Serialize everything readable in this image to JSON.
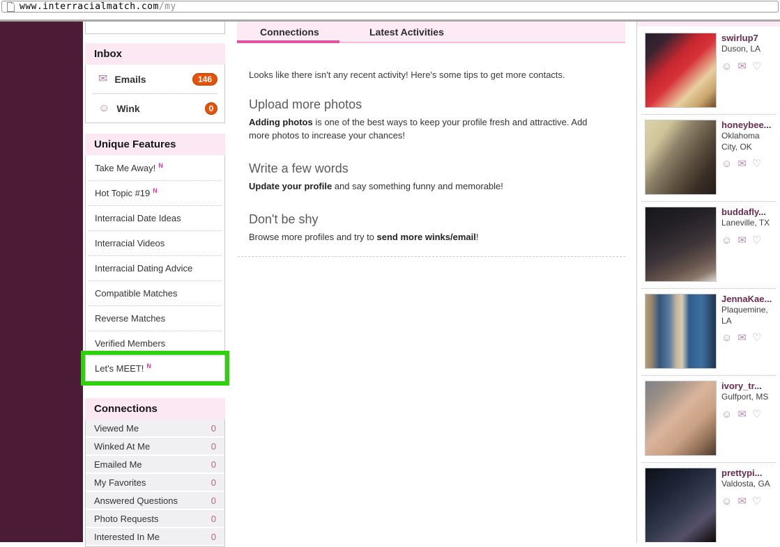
{
  "browser": {
    "url_main": "www.interracialmatch.com",
    "url_path": "/my"
  },
  "icons": {
    "envelope": "✉",
    "smiley": "☺",
    "heart": "♡"
  },
  "colors": {
    "brand_purple": "#4c1c37",
    "header_pink": "#fbe8f3",
    "tab_strip_pink": "#fdeaf5",
    "active_tab_underline": "#e1559f",
    "badge_orange": "#e35309",
    "highlight_green": "#2fd10c",
    "count_pink": "#b4647f"
  },
  "sidebar": {
    "inbox": {
      "title": "Inbox",
      "emails": {
        "label": "Emails",
        "badge": "146"
      },
      "wink": {
        "label": "Wink",
        "badge": "0"
      }
    },
    "unique_features": {
      "title": "Unique Features",
      "new_marker": "N",
      "items": [
        {
          "label": "Take Me Away!",
          "new": true
        },
        {
          "label": "Hot Topic #19",
          "new": true
        },
        {
          "label": "Interracial Date Ideas"
        },
        {
          "label": "Interracial Videos"
        },
        {
          "label": "Interracial Dating Advice"
        },
        {
          "label": "Compatible Matches"
        },
        {
          "label": "Reverse Matches"
        },
        {
          "label": "Verified Members"
        },
        {
          "label": "Let's MEET!",
          "new": true,
          "highlighted": true
        }
      ]
    },
    "connections": {
      "title": "Connections",
      "items": [
        {
          "label": "Viewed Me",
          "count": "0"
        },
        {
          "label": "Winked At Me",
          "count": "0"
        },
        {
          "label": "Emailed Me",
          "count": "0"
        },
        {
          "label": "My Favorites",
          "count": "0"
        },
        {
          "label": "Answered Questions",
          "count": "0"
        },
        {
          "label": "Photo Requests",
          "count": "0"
        },
        {
          "label": "Interested In Me",
          "count": "0"
        }
      ]
    }
  },
  "main": {
    "tabs": [
      {
        "label": "Connections",
        "active": true
      },
      {
        "label": "Latest Activities",
        "active": false
      }
    ],
    "intro": "Looks like there isn't any recent activity! Here's some tips to get more contacts.",
    "tips": [
      {
        "heading": "Upload more photos",
        "lead": "",
        "bold": "Adding photos",
        "rest": " is one of the best ways to keep your profile fresh and attractive. Add more photos to increase your chances!"
      },
      {
        "heading": "Write a few words",
        "lead": "",
        "bold": "Update your profile",
        "rest": " and say something funny and memorable!"
      },
      {
        "heading": "Don't be shy",
        "lead": "Browse more profiles and try to ",
        "bold": "send more winks/email",
        "rest": "!"
      }
    ]
  },
  "profiles": [
    {
      "name": "swirlup7",
      "location": "Duson, LA",
      "photo": "linear-gradient(135deg,#23202e 0%,#3a2430 18%,#c3272e 38%,#d8323a 52%,#e7cfa0 72%,#caa36a 86%,#6d4a2a 100%)"
    },
    {
      "name": "honeybee...",
      "location": "Oklahoma City, OK",
      "photo": "linear-gradient(125deg,#ded3a8 0%,#cfc39a 22%,#8c8168 40%,#5c4f3e 62%,#3a2f26 80%,#241d18 100%)"
    },
    {
      "name": "buddafly...",
      "location": "Laneville, TX",
      "photo": "linear-gradient(155deg,#17171a 0%,#242127 30%,#3c3438 55%,#65544c 75%,#8a786c 88%,#d9d5d1 100%)"
    },
    {
      "name": "JennaKae...",
      "location": "Plaquemine, LA",
      "photo": "linear-gradient(90deg,#b59a78 0%,#9c8a6d 8%,#34557c 20%,#5a7da0 34%,#c3b49a 44%,#d6cbb2 52%,#2e5d8f 62%,#3f6f9e 80%,#1d3550 100%)"
    },
    {
      "name": "ivory_tr...",
      "location": "Gulfport, MS",
      "photo": "linear-gradient(135deg,#7d828a 0%,#9b8f85 20%,#d9b49c 45%,#caa184 65%,#8a6a52 85%,#4a3a2e 100%)"
    },
    {
      "name": "prettypi...",
      "location": "Valdosta, GA",
      "photo": "linear-gradient(140deg,#0d1119 0%,#1c2333 30%,#333a4e 55%,#55506a 75%,#241f26 92%,#0f0c0e 100%)"
    }
  ]
}
